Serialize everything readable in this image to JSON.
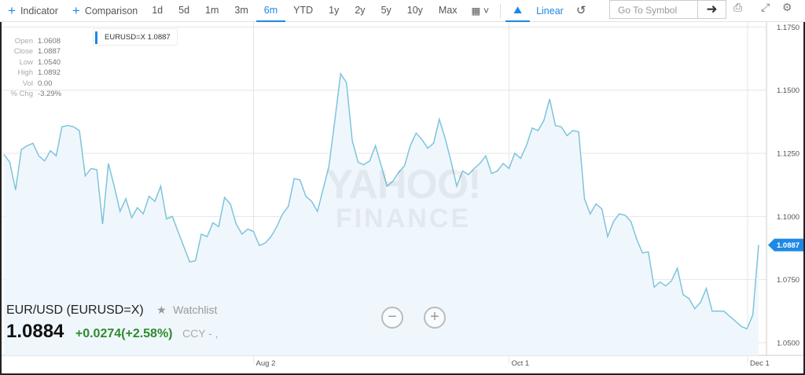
{
  "toolbar": {
    "indicator": "Indicator",
    "comparison": "Comparison",
    "ranges": [
      "1d",
      "5d",
      "1m",
      "3m",
      "6m",
      "YTD",
      "1y",
      "2y",
      "5y",
      "10y",
      "Max"
    ],
    "active_range": "6m",
    "scale": "Linear",
    "search_placeholder": "Go To Symbol"
  },
  "ohlc": [
    {
      "k": "Open",
      "v": "1.0608"
    },
    {
      "k": "Close",
      "v": "1.0887"
    },
    {
      "k": "Low",
      "v": "1.0540"
    },
    {
      "k": "High",
      "v": "1.0892"
    },
    {
      "k": "Vol",
      "v": "0.00"
    },
    {
      "k": "% Chg",
      "v": "-3.29%"
    }
  ],
  "legend": "EURUSD=X 1.0887",
  "quote": {
    "name": "EUR/USD (EURUSD=X)",
    "watchlist": "Watchlist",
    "price": "1.0884",
    "change": "+0.0274(+2.58%)",
    "ccy": "CCY - ,"
  },
  "watermark": {
    "line1": "YAHOO!",
    "line2": "FINANCE"
  },
  "colors": {
    "accent": "#1e88e5",
    "line": "#7ec4dc",
    "fill": "#f0f7fc",
    "up": "#2e8b2e"
  },
  "chart_data": {
    "type": "area",
    "ylim": [
      1.045,
      1.177
    ],
    "y_ticks": [
      "1.1750",
      "1.1500",
      "1.1250",
      "1.1000",
      "1.0750",
      "1.0500"
    ],
    "x_ticks": [
      "Aug 2",
      "Oct 1",
      "Dec 1"
    ],
    "last_label": "1.0887",
    "series": [
      {
        "values": [
          1.1245,
          1.1215,
          1.1105,
          1.1265,
          1.128,
          1.129,
          1.124,
          1.122,
          1.126,
          1.124,
          1.1355,
          1.136,
          1.1355,
          1.134,
          1.116,
          1.119,
          1.1185,
          1.097,
          1.121,
          1.112,
          1.102,
          1.107,
          1.0995,
          1.1035,
          1.101,
          1.108,
          1.106,
          1.112,
          1.099,
          1.1,
          1.094,
          1.088,
          1.082,
          1.0825,
          1.093,
          1.092,
          1.0975,
          1.096,
          1.1075,
          1.105,
          1.097,
          1.093,
          1.095,
          1.094,
          1.0885,
          1.0895,
          1.092,
          1.096,
          1.101,
          1.104,
          1.115,
          1.1145,
          1.108,
          1.106,
          1.102,
          1.111,
          1.12,
          1.138,
          1.1565,
          1.153,
          1.13,
          1.1215,
          1.1205,
          1.122,
          1.128,
          1.12,
          1.112,
          1.114,
          1.1175,
          1.12,
          1.128,
          1.133,
          1.1305,
          1.127,
          1.129,
          1.1385,
          1.131,
          1.122,
          1.112,
          1.118,
          1.1165,
          1.119,
          1.121,
          1.124,
          1.117,
          1.118,
          1.121,
          1.119,
          1.125,
          1.123,
          1.128,
          1.135,
          1.134,
          1.138,
          1.1465,
          1.136,
          1.1355,
          1.132,
          1.134,
          1.1335,
          1.107,
          1.101,
          1.105,
          1.103,
          1.092,
          1.098,
          1.101,
          1.1005,
          1.098,
          1.091,
          1.0855,
          1.086,
          1.072,
          1.074,
          1.0725,
          1.0745,
          1.0795,
          1.069,
          1.0675,
          1.0635,
          1.066,
          1.0715,
          1.0625,
          1.0625,
          1.0625,
          1.0605,
          1.0585,
          1.0565,
          1.0555,
          1.061,
          1.0887
        ]
      }
    ]
  }
}
